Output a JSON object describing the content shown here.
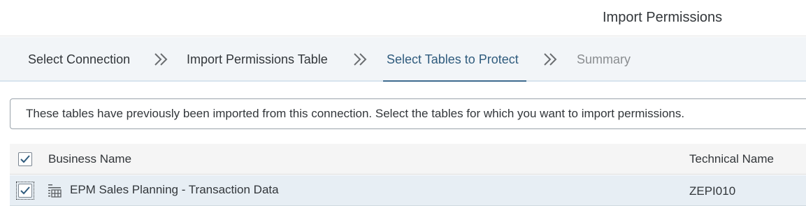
{
  "header": {
    "title": "Import Permissions"
  },
  "wizard": {
    "steps": [
      {
        "label": "Select Connection",
        "state": "done"
      },
      {
        "label": "Import Permissions Table",
        "state": "done"
      },
      {
        "label": "Select Tables to Protect",
        "state": "active"
      },
      {
        "label": "Summary",
        "state": "pending"
      }
    ]
  },
  "info": {
    "message": "These tables have previously been imported from this connection. Select the tables for which you want to import permissions."
  },
  "table": {
    "columns": [
      "Business Name",
      "Technical Name"
    ],
    "select_all_checked": true,
    "rows": [
      {
        "business_name": "EPM Sales Planning - Transaction Data",
        "technical_name": "ZEPI010",
        "checked": true,
        "icon": "table-icon"
      }
    ]
  },
  "colors": {
    "accent": "#2f5b7d",
    "wizard_bg": "#f2f5f8",
    "row_selected": "#e7eef4"
  }
}
